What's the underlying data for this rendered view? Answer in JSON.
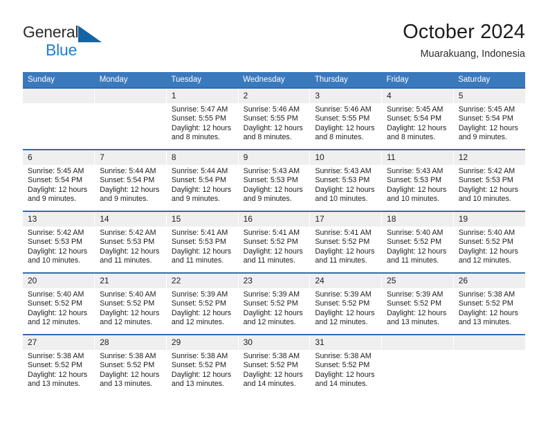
{
  "brand": {
    "line1": "General",
    "line2": "Blue",
    "triangle_icon": "brand-triangle-icon",
    "colors": {
      "text": "#2b2b2b",
      "blue": "#1a7fd4"
    }
  },
  "header": {
    "title": "October 2024",
    "subtitle": "Muarakuang, Indonesia"
  },
  "colors": {
    "header_row_bg": "#3b79bd",
    "week_border": "#2f6cb0",
    "daynum_bg": "#efefef",
    "cell_bg": "#ffffff"
  },
  "weekdays": [
    "Sunday",
    "Monday",
    "Tuesday",
    "Wednesday",
    "Thursday",
    "Friday",
    "Saturday"
  ],
  "weeks": [
    [
      {
        "day": "",
        "empty": true,
        "sunrise": "",
        "sunset": "",
        "daylight1": "",
        "daylight2": ""
      },
      {
        "day": "",
        "empty": true,
        "sunrise": "",
        "sunset": "",
        "daylight1": "",
        "daylight2": ""
      },
      {
        "day": "1",
        "sunrise": "Sunrise: 5:47 AM",
        "sunset": "Sunset: 5:55 PM",
        "daylight1": "Daylight: 12 hours",
        "daylight2": "and 8 minutes."
      },
      {
        "day": "2",
        "sunrise": "Sunrise: 5:46 AM",
        "sunset": "Sunset: 5:55 PM",
        "daylight1": "Daylight: 12 hours",
        "daylight2": "and 8 minutes."
      },
      {
        "day": "3",
        "sunrise": "Sunrise: 5:46 AM",
        "sunset": "Sunset: 5:55 PM",
        "daylight1": "Daylight: 12 hours",
        "daylight2": "and 8 minutes."
      },
      {
        "day": "4",
        "sunrise": "Sunrise: 5:45 AM",
        "sunset": "Sunset: 5:54 PM",
        "daylight1": "Daylight: 12 hours",
        "daylight2": "and 8 minutes."
      },
      {
        "day": "5",
        "sunrise": "Sunrise: 5:45 AM",
        "sunset": "Sunset: 5:54 PM",
        "daylight1": "Daylight: 12 hours",
        "daylight2": "and 9 minutes."
      }
    ],
    [
      {
        "day": "6",
        "sunrise": "Sunrise: 5:45 AM",
        "sunset": "Sunset: 5:54 PM",
        "daylight1": "Daylight: 12 hours",
        "daylight2": "and 9 minutes."
      },
      {
        "day": "7",
        "sunrise": "Sunrise: 5:44 AM",
        "sunset": "Sunset: 5:54 PM",
        "daylight1": "Daylight: 12 hours",
        "daylight2": "and 9 minutes."
      },
      {
        "day": "8",
        "sunrise": "Sunrise: 5:44 AM",
        "sunset": "Sunset: 5:54 PM",
        "daylight1": "Daylight: 12 hours",
        "daylight2": "and 9 minutes."
      },
      {
        "day": "9",
        "sunrise": "Sunrise: 5:43 AM",
        "sunset": "Sunset: 5:53 PM",
        "daylight1": "Daylight: 12 hours",
        "daylight2": "and 9 minutes."
      },
      {
        "day": "10",
        "sunrise": "Sunrise: 5:43 AM",
        "sunset": "Sunset: 5:53 PM",
        "daylight1": "Daylight: 12 hours",
        "daylight2": "and 10 minutes."
      },
      {
        "day": "11",
        "sunrise": "Sunrise: 5:43 AM",
        "sunset": "Sunset: 5:53 PM",
        "daylight1": "Daylight: 12 hours",
        "daylight2": "and 10 minutes."
      },
      {
        "day": "12",
        "sunrise": "Sunrise: 5:42 AM",
        "sunset": "Sunset: 5:53 PM",
        "daylight1": "Daylight: 12 hours",
        "daylight2": "and 10 minutes."
      }
    ],
    [
      {
        "day": "13",
        "sunrise": "Sunrise: 5:42 AM",
        "sunset": "Sunset: 5:53 PM",
        "daylight1": "Daylight: 12 hours",
        "daylight2": "and 10 minutes."
      },
      {
        "day": "14",
        "sunrise": "Sunrise: 5:42 AM",
        "sunset": "Sunset: 5:53 PM",
        "daylight1": "Daylight: 12 hours",
        "daylight2": "and 11 minutes."
      },
      {
        "day": "15",
        "sunrise": "Sunrise: 5:41 AM",
        "sunset": "Sunset: 5:53 PM",
        "daylight1": "Daylight: 12 hours",
        "daylight2": "and 11 minutes."
      },
      {
        "day": "16",
        "sunrise": "Sunrise: 5:41 AM",
        "sunset": "Sunset: 5:52 PM",
        "daylight1": "Daylight: 12 hours",
        "daylight2": "and 11 minutes."
      },
      {
        "day": "17",
        "sunrise": "Sunrise: 5:41 AM",
        "sunset": "Sunset: 5:52 PM",
        "daylight1": "Daylight: 12 hours",
        "daylight2": "and 11 minutes."
      },
      {
        "day": "18",
        "sunrise": "Sunrise: 5:40 AM",
        "sunset": "Sunset: 5:52 PM",
        "daylight1": "Daylight: 12 hours",
        "daylight2": "and 11 minutes."
      },
      {
        "day": "19",
        "sunrise": "Sunrise: 5:40 AM",
        "sunset": "Sunset: 5:52 PM",
        "daylight1": "Daylight: 12 hours",
        "daylight2": "and 12 minutes."
      }
    ],
    [
      {
        "day": "20",
        "sunrise": "Sunrise: 5:40 AM",
        "sunset": "Sunset: 5:52 PM",
        "daylight1": "Daylight: 12 hours",
        "daylight2": "and 12 minutes."
      },
      {
        "day": "21",
        "sunrise": "Sunrise: 5:40 AM",
        "sunset": "Sunset: 5:52 PM",
        "daylight1": "Daylight: 12 hours",
        "daylight2": "and 12 minutes."
      },
      {
        "day": "22",
        "sunrise": "Sunrise: 5:39 AM",
        "sunset": "Sunset: 5:52 PM",
        "daylight1": "Daylight: 12 hours",
        "daylight2": "and 12 minutes."
      },
      {
        "day": "23",
        "sunrise": "Sunrise: 5:39 AM",
        "sunset": "Sunset: 5:52 PM",
        "daylight1": "Daylight: 12 hours",
        "daylight2": "and 12 minutes."
      },
      {
        "day": "24",
        "sunrise": "Sunrise: 5:39 AM",
        "sunset": "Sunset: 5:52 PM",
        "daylight1": "Daylight: 12 hours",
        "daylight2": "and 12 minutes."
      },
      {
        "day": "25",
        "sunrise": "Sunrise: 5:39 AM",
        "sunset": "Sunset: 5:52 PM",
        "daylight1": "Daylight: 12 hours",
        "daylight2": "and 13 minutes."
      },
      {
        "day": "26",
        "sunrise": "Sunrise: 5:38 AM",
        "sunset": "Sunset: 5:52 PM",
        "daylight1": "Daylight: 12 hours",
        "daylight2": "and 13 minutes."
      }
    ],
    [
      {
        "day": "27",
        "sunrise": "Sunrise: 5:38 AM",
        "sunset": "Sunset: 5:52 PM",
        "daylight1": "Daylight: 12 hours",
        "daylight2": "and 13 minutes."
      },
      {
        "day": "28",
        "sunrise": "Sunrise: 5:38 AM",
        "sunset": "Sunset: 5:52 PM",
        "daylight1": "Daylight: 12 hours",
        "daylight2": "and 13 minutes."
      },
      {
        "day": "29",
        "sunrise": "Sunrise: 5:38 AM",
        "sunset": "Sunset: 5:52 PM",
        "daylight1": "Daylight: 12 hours",
        "daylight2": "and 13 minutes."
      },
      {
        "day": "30",
        "sunrise": "Sunrise: 5:38 AM",
        "sunset": "Sunset: 5:52 PM",
        "daylight1": "Daylight: 12 hours",
        "daylight2": "and 14 minutes."
      },
      {
        "day": "31",
        "sunrise": "Sunrise: 5:38 AM",
        "sunset": "Sunset: 5:52 PM",
        "daylight1": "Daylight: 12 hours",
        "daylight2": "and 14 minutes."
      },
      {
        "day": "",
        "empty": true,
        "sunrise": "",
        "sunset": "",
        "daylight1": "",
        "daylight2": ""
      },
      {
        "day": "",
        "empty": true,
        "sunrise": "",
        "sunset": "",
        "daylight1": "",
        "daylight2": ""
      }
    ]
  ]
}
